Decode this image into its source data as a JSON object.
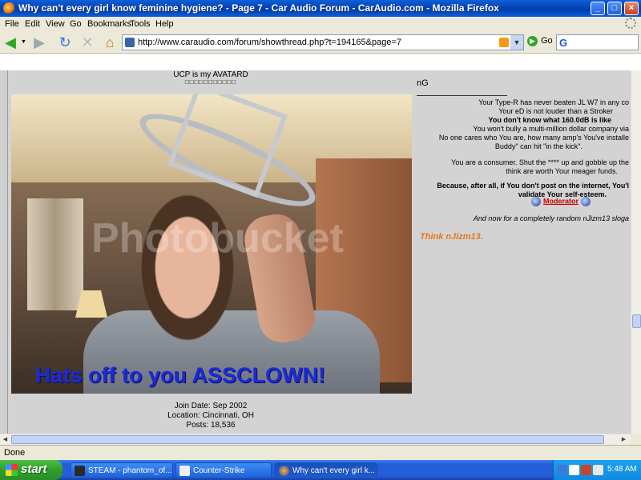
{
  "window": {
    "title": "Why can't every girl know feminine hygiene? - Page 7 - Car Audio Forum - CarAudio.com - Mozilla Firefox",
    "minimize_label": "_",
    "maximize_label": "□",
    "close_label": "×"
  },
  "menu": [
    "File",
    "Edit",
    "View",
    "Go",
    "Bookmarks",
    "Tools",
    "Help"
  ],
  "nav": {
    "url": "http://www.caraudio.com/forum/showthread.php?t=194165&page=7",
    "go_label": "Go",
    "search_glyph": "G"
  },
  "post": {
    "user_title": "UCP is my AVATARD",
    "user_title_boxes": "□□□□□□□□□□□",
    "avatar_caption": "Hats off to you ASSCLOWN!",
    "watermark": "Photobucket",
    "join_date": "Join Date: Sep 2002",
    "location": "Location: Cincinnati, OH",
    "posts": "Posts: 18,536",
    "message": "nG",
    "signature": {
      "line1": "Your Type-R has never beaten JL W7 in any co",
      "line2": "Your eD is not louder than a Stroker",
      "line3": "You don't know what 160.0dB is like",
      "line4": "You won't bully a multi-million dollar company via",
      "line5": "No one cares who You are, how many amp's You've installe",
      "line6": "Buddy\" can hit \"in the kick\".",
      "line7": "You are a consumer. Shut the **** up and gobble up the",
      "line8": "think are worth Your meager funds.",
      "line9": "Because, after all, if You don't post on the internet, You'l",
      "line10": "validate Your self-esteem.",
      "moderator": "Moderator",
      "line11": "And now for a completely random nJizm13 sloga",
      "think": "Think nJizm13."
    }
  },
  "status": "Done",
  "taskbar": {
    "start": "start",
    "tasks": [
      "STEAM - phantom_of...",
      "Counter-Strike",
      "Why can't every girl k..."
    ],
    "clock": "5:48 AM"
  }
}
